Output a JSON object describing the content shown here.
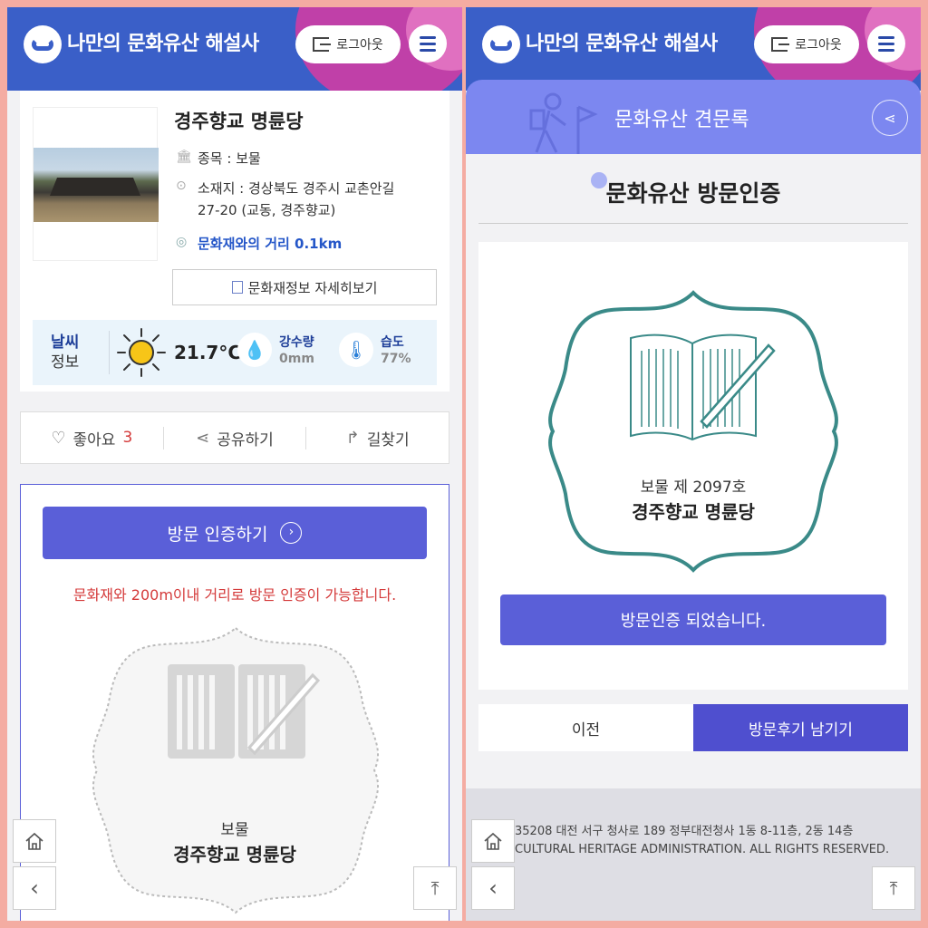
{
  "app": {
    "title": "나만의 문화유산 해설사",
    "logout_label": "로그아웃"
  },
  "left": {
    "heritage": {
      "name": "경주향교 명륜당",
      "category_label": "종목 : 보물",
      "address_line1": "소재지 : 경상북도 경주시 교촌안길",
      "address_line2": "27-20 (교동, 경주향교)",
      "distance": "문화재와의 거리 0.1km",
      "detail_button": "문화재정보 자세히보기"
    },
    "weather": {
      "label_1": "날씨",
      "label_2": "정보",
      "temperature": "21.7°C",
      "rain_label": "강수량",
      "rain_value": "0mm",
      "humidity_label": "습도",
      "humidity_value": "77%"
    },
    "actions": {
      "like_label": "좋아요",
      "like_count": "3",
      "share_label": "공유하기",
      "directions_label": "길찾기"
    },
    "visit": {
      "button_label": "방문 인증하기",
      "notice": "문화재와 200m이내 거리로 방문 인증이 가능합니다.",
      "badge_category": "보물",
      "badge_name": "경주향교 명륜당"
    }
  },
  "right": {
    "section_title": "문화유산 견문록",
    "page_title": "문화유산 방문인증",
    "badge_category": "보물 제 2097호",
    "badge_name": "경주향교 명륜당",
    "done_label": "방문인증 되었습니다.",
    "prev_label": "이전",
    "review_label": "방문후기 남기기",
    "footer_address": "35208 대전 서구 청사로 189 정부대전청사 1동 8-11층, 2동 14층",
    "footer_copyright": "CULTURAL HERITAGE ADMINISTRATION. ALL RIGHTS RESERVED."
  },
  "colors": {
    "header": "#3a5fc8",
    "accent": "#5a5fd8",
    "danger": "#d43a3a",
    "badge_teal": "#3a8a88"
  },
  "icons": [
    "search-icon",
    "menu-icon",
    "logout-icon",
    "heart-icon",
    "share-icon",
    "directions-icon",
    "home-icon",
    "back-icon",
    "scroll-top-icon"
  ]
}
